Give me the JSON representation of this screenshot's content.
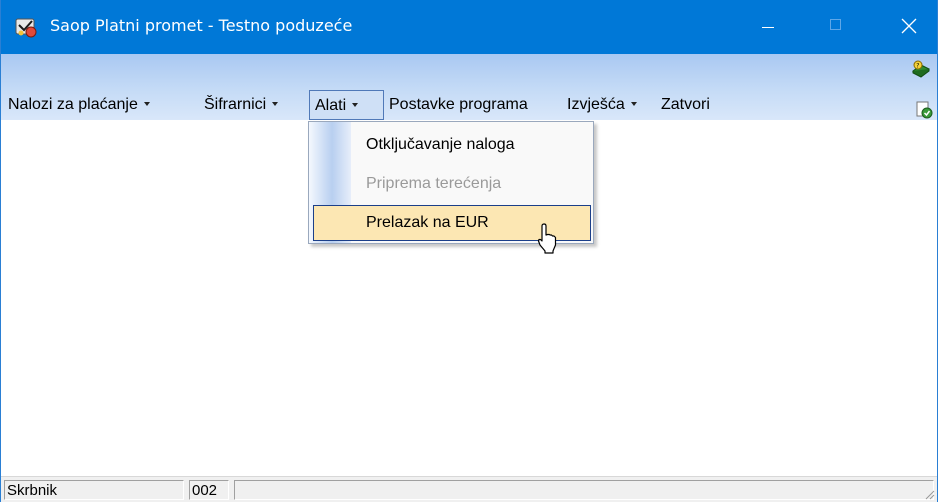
{
  "window": {
    "title": "Saop  Platni promet - Testno poduzeće",
    "titlebar_color": "#0078d7",
    "icons": {
      "app": "app-logo-icon",
      "minimize": "minimize-icon",
      "maximize": "maximize-icon",
      "close": "close-icon"
    }
  },
  "menubar": {
    "items": [
      {
        "label": "Nalozi za plaćanje",
        "has_arrow": true
      },
      {
        "label": "Šifrarnici",
        "has_arrow": true
      },
      {
        "label": "Alati",
        "has_arrow": true,
        "active": true
      },
      {
        "label": "Postavke programa",
        "has_arrow": false
      },
      {
        "label": "Izvješća",
        "has_arrow": true
      },
      {
        "label": "Zatvori",
        "has_arrow": false
      }
    ],
    "right_icons": [
      "help-book-icon",
      "check-document-icon"
    ]
  },
  "dropdown": {
    "items": [
      {
        "label": "Otključavanje naloga",
        "enabled": true
      },
      {
        "label": "Priprema terećenja",
        "enabled": false
      },
      {
        "label": "Prelazak na EUR",
        "enabled": true,
        "highlighted": true
      }
    ],
    "highlight_color": "#fce7b3"
  },
  "statusbar": {
    "user": "Skrbnik",
    "code": "002",
    "info": ""
  }
}
